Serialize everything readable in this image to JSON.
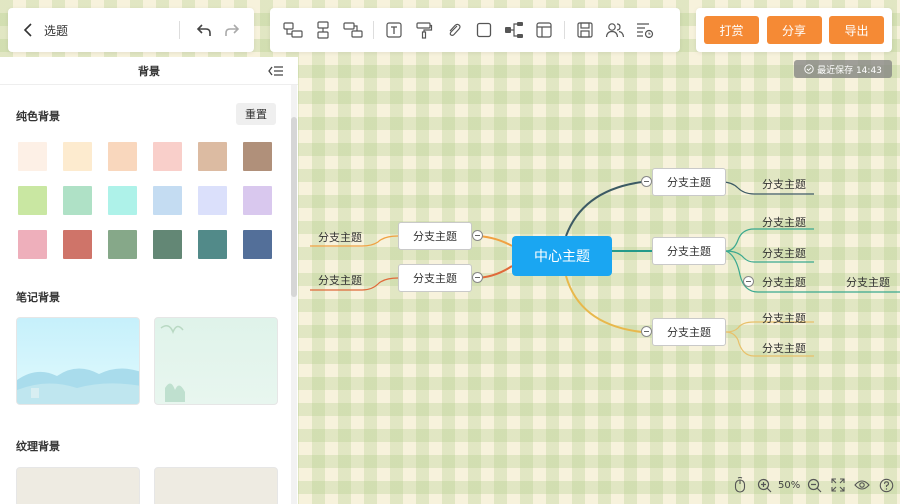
{
  "header": {
    "doc_title": "选题",
    "back_icon": "chevron-left-icon",
    "undo_icon": "undo-icon",
    "redo_icon": "redo-icon"
  },
  "toolbar": {
    "tools": [
      "insert-sibling-icon",
      "insert-child-icon",
      "insert-parent-icon",
      "text-box-icon",
      "format-painter-icon",
      "attachment-icon",
      "border-box-icon",
      "structure-icon",
      "layout-icon",
      "save-icon",
      "people-icon",
      "outline-icon"
    ]
  },
  "actions": {
    "reward_label": "打赏",
    "share_label": "分享",
    "export_label": "导出",
    "accent_color": "#f58a35"
  },
  "save_status": "最近保存 14:43",
  "panel": {
    "title": "背景",
    "solid_title": "纯色背景",
    "reset_label": "重置",
    "swatches": [
      "#fdf0e6",
      "#fdebcf",
      "#f9d7bd",
      "#f9cfca",
      "#dcbba2",
      "#b0907a",
      "#c9e7a2",
      "#afe1c6",
      "#aef2e9",
      "#c4dcf2",
      "#dbe0fb",
      "#d9c8ee",
      "#eeafbb",
      "#cf7469",
      "#86a889",
      "#638775",
      "#528a89",
      "#536f99"
    ],
    "note_title": "笔记背景",
    "texture_title": "纹理背景"
  },
  "mindmap": {
    "center": "中心主题",
    "center_color": "#1aa6f2",
    "right_branches": [
      {
        "label": "分支主题",
        "children": [
          "分支主题"
        ]
      },
      {
        "label": "分支主题",
        "children": [
          "分支主题",
          "分支主题",
          "分支主题"
        ],
        "grandchild": "分支主题"
      },
      {
        "label": "分支主题",
        "children": [
          "分支主题",
          "分支主题"
        ]
      }
    ],
    "left_branches": [
      {
        "label": "分支主题",
        "children": [
          "分支主题"
        ]
      },
      {
        "label": "分支主题",
        "children": [
          "分支主题"
        ]
      }
    ]
  },
  "footer": {
    "zoom": "50%"
  }
}
